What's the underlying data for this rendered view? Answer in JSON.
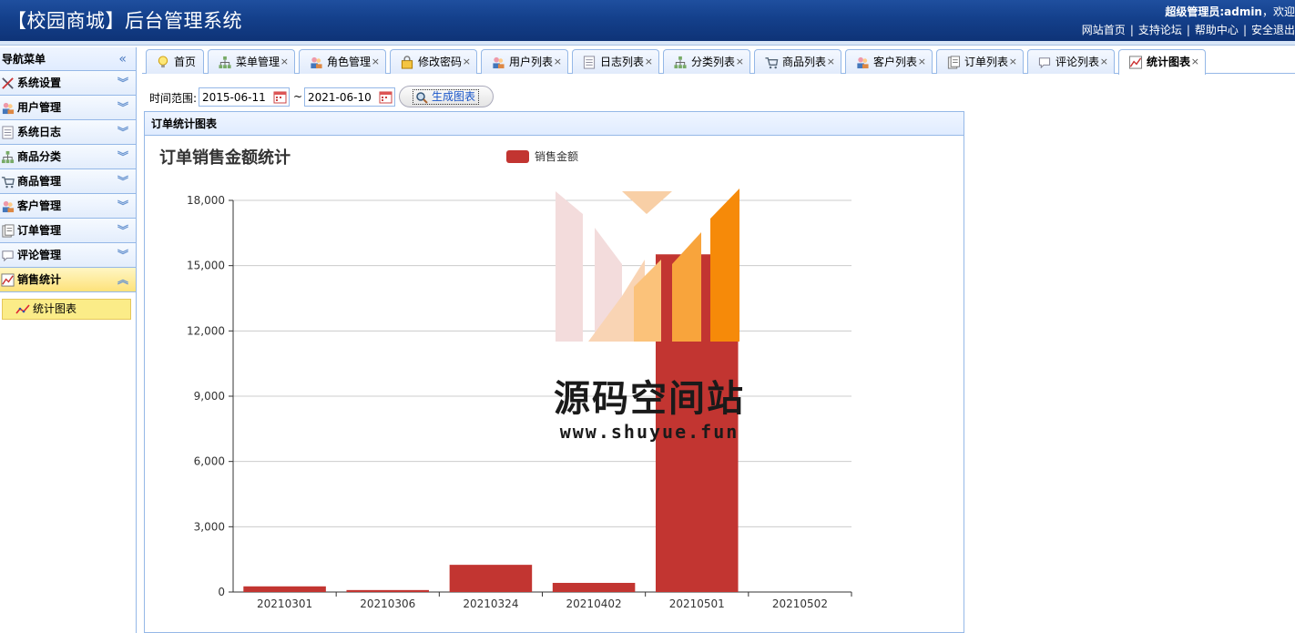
{
  "header": {
    "title": "【校园商城】后台管理系统",
    "user": "超级管理员:admin",
    "welcome": "，欢迎",
    "links": [
      "网站首页",
      "支持论坛",
      "帮助中心",
      "安全退出"
    ]
  },
  "sidebar": {
    "title": "导航菜单",
    "items": [
      {
        "label": "系统设置",
        "icon": "tools-icon"
      },
      {
        "label": "用户管理",
        "icon": "users-icon"
      },
      {
        "label": "系统日志",
        "icon": "log-icon"
      },
      {
        "label": "商品分类",
        "icon": "category-icon"
      },
      {
        "label": "商品管理",
        "icon": "goods-icon"
      },
      {
        "label": "客户管理",
        "icon": "customers-icon"
      },
      {
        "label": "订单管理",
        "icon": "orders-icon"
      },
      {
        "label": "评论管理",
        "icon": "comment-icon"
      },
      {
        "label": "销售统计",
        "icon": "chart-icon",
        "active": true
      }
    ],
    "sub_item": "统计图表"
  },
  "tabs": [
    {
      "label": "首页",
      "icon": "bulb-icon",
      "closable": false
    },
    {
      "label": "菜单管理",
      "icon": "tree-icon",
      "closable": true
    },
    {
      "label": "角色管理",
      "icon": "role-icon",
      "closable": true
    },
    {
      "label": "修改密码",
      "icon": "password-icon",
      "closable": true
    },
    {
      "label": "用户列表",
      "icon": "users-icon",
      "closable": true
    },
    {
      "label": "日志列表",
      "icon": "log-icon",
      "closable": true
    },
    {
      "label": "分类列表",
      "icon": "category-icon",
      "closable": true
    },
    {
      "label": "商品列表",
      "icon": "cart-icon",
      "closable": true
    },
    {
      "label": "客户列表",
      "icon": "customers-icon",
      "closable": true
    },
    {
      "label": "订单列表",
      "icon": "orders-icon",
      "closable": true
    },
    {
      "label": "评论列表",
      "icon": "comment-icon",
      "closable": true
    },
    {
      "label": "统计图表",
      "icon": "chart-icon",
      "closable": true,
      "active": true
    }
  ],
  "filter": {
    "label": "时间范围:",
    "start_date": "2015-06-11",
    "separator": "~",
    "end_date": "2021-06-10",
    "button": "生成图表"
  },
  "panel": {
    "title": "订单统计图表"
  },
  "chart_data": {
    "type": "bar",
    "title": "订单销售金额统计",
    "legend": "销售金额",
    "legend_position": "top-center",
    "color": "#c23531",
    "categories": [
      "20210301",
      "20210306",
      "20210324",
      "20210402",
      "20210501",
      "20210502"
    ],
    "values": [
      260,
      90,
      1250,
      420,
      15520,
      0
    ],
    "ylim": [
      0,
      18000
    ],
    "yticks": [
      "0",
      "3,000",
      "6,000",
      "9,000",
      "12,000",
      "15,000",
      "18,000"
    ],
    "grid": true
  },
  "watermark": {
    "title": "源码空间站",
    "url": "www.shuyue.fun"
  }
}
